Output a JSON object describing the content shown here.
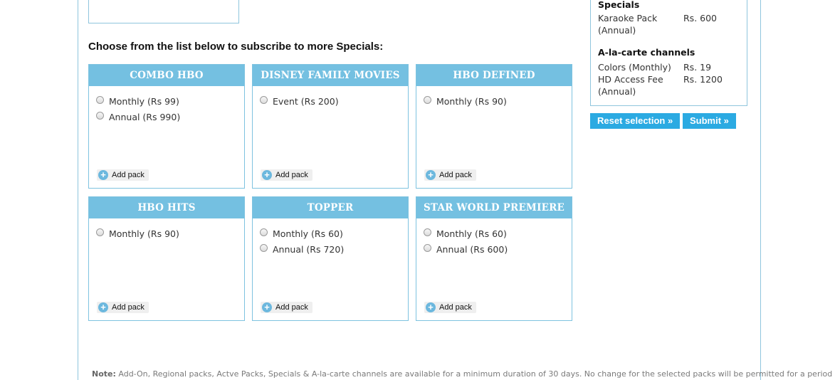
{
  "page": {
    "heading": "Choose from the list below to subscribe to more Specials:",
    "add_pack_label": "Add pack"
  },
  "packs": [
    {
      "title": "COMBO HBO",
      "options": [
        "Monthly (Rs 99)",
        "Annual (Rs 990)"
      ]
    },
    {
      "title": "DISNEY FAMILY MOVIES",
      "options": [
        "Event (Rs 200)"
      ]
    },
    {
      "title": "HBO DEFINED",
      "options": [
        "Monthly (Rs 90)"
      ]
    },
    {
      "title": "HBO HITS",
      "options": [
        "Monthly (Rs 90)"
      ]
    },
    {
      "title": "TOPPER",
      "options": [
        "Monthly (Rs 60)",
        "Annual (Rs 720)"
      ]
    },
    {
      "title": "STAR WORLD PREMIERE",
      "options": [
        "Monthly (Rs 60)",
        "Annual (Rs 600)"
      ]
    }
  ],
  "summary": {
    "specials_title": "Specials",
    "specials": [
      {
        "name": "Karaoke Pack",
        "price": "Rs. 600",
        "period": "(Annual)"
      }
    ],
    "alacarte_title": "A-la-carte channels",
    "alacarte": [
      {
        "name": "Colors (Monthly)",
        "price": "Rs. 19"
      },
      {
        "name": "HD Access Fee",
        "price": "Rs. 1200",
        "period": "(Annual)"
      }
    ]
  },
  "buttons": {
    "reset": "Reset selection »",
    "submit": "Submit »"
  },
  "note": {
    "label": "Note:",
    "text": " Add-On, Regional packs, Actve Packs, Specials & A-la-carte channels are available for a minimum duration of 30 days. No change for the selected packs will be permitted for a period of"
  },
  "colors": {
    "pack_header": "#74c0e1",
    "button": "#2baae2",
    "border": "#8fc5dd"
  }
}
